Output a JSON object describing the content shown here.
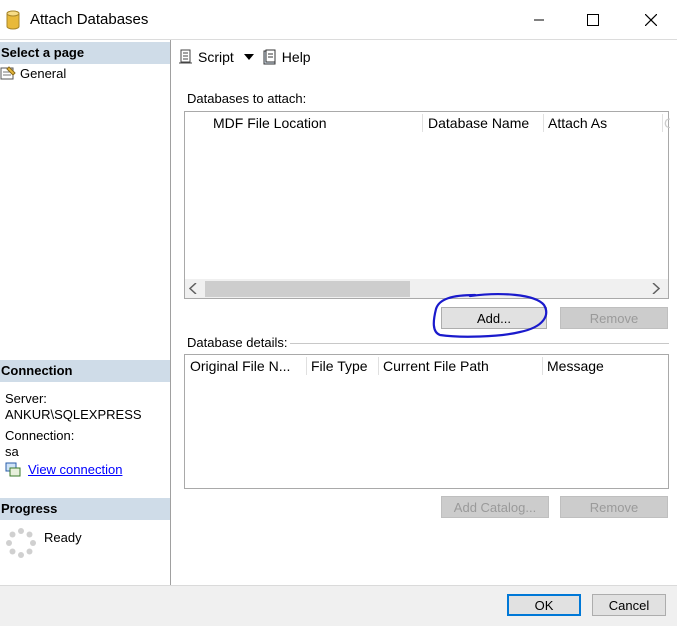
{
  "window": {
    "title": "Attach Databases",
    "icons": {
      "app": "database-cylinder-icon",
      "minimize": "minimize-icon",
      "maximize": "maximize-icon",
      "close": "close-icon"
    }
  },
  "left": {
    "select_page_title": "Select a page",
    "pages": [
      {
        "label": "General",
        "icon": "general-page-icon"
      }
    ],
    "connection_title": "Connection",
    "server_label": "Server:",
    "server_value": "ANKUR\\SQLEXPRESS",
    "connection_label": "Connection:",
    "connection_value": "sa",
    "view_connection_link": "View connection",
    "progress_title": "Progress",
    "progress_status": "Ready"
  },
  "toolbar": {
    "script_label": "Script",
    "help_label": "Help"
  },
  "attach": {
    "group_label": "Databases to attach:",
    "columns": [
      "MDF File Location",
      "Database Name",
      "Attach As",
      "O"
    ],
    "rows": [],
    "add_button": "Add...",
    "remove_button": "Remove"
  },
  "details": {
    "group_label": "Database details:",
    "columns": [
      "Original File N...",
      "File Type",
      "Current File Path",
      "Message"
    ],
    "rows": [],
    "add_catalog_button": "Add Catalog...",
    "remove_button": "Remove"
  },
  "footer": {
    "ok_label": "OK",
    "cancel_label": "Cancel"
  },
  "colors": {
    "section_header": "#cfdce8",
    "link": "#0000ff",
    "annotation": "#1a1acc",
    "default_border": "#0078d7"
  }
}
